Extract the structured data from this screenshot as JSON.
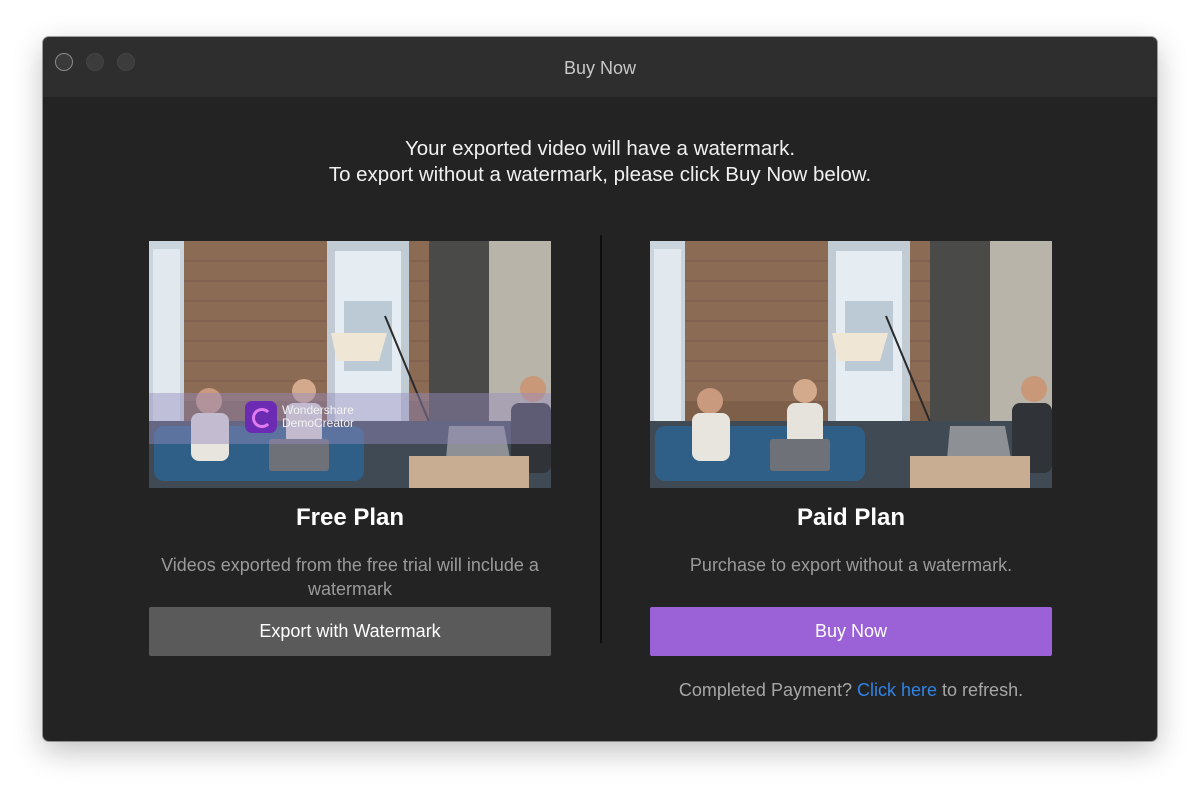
{
  "window": {
    "title": "Buy Now",
    "controls": [
      "close",
      "minimize",
      "maximize"
    ]
  },
  "notice": {
    "line1": "Your exported video will have a watermark.",
    "line2": "To export without a watermark, please click Buy Now below."
  },
  "free_plan": {
    "title": "Free Plan",
    "description": "Videos exported from the free trial will include a watermark",
    "button_label": "Export with Watermark",
    "watermark": {
      "brand_line1": "Wondershare",
      "brand_line2": "DemoCreator"
    }
  },
  "paid_plan": {
    "title": "Paid Plan",
    "description": "Purchase to export without a watermark.",
    "button_label": "Buy Now"
  },
  "refresh": {
    "prefix": "Completed Payment?",
    "link": "Click here",
    "suffix": "to refresh."
  },
  "colors": {
    "accent": "#9a62d6",
    "link": "#2f83e6",
    "window_bg": "#232323",
    "secondary_button": "#5a5a5a"
  }
}
